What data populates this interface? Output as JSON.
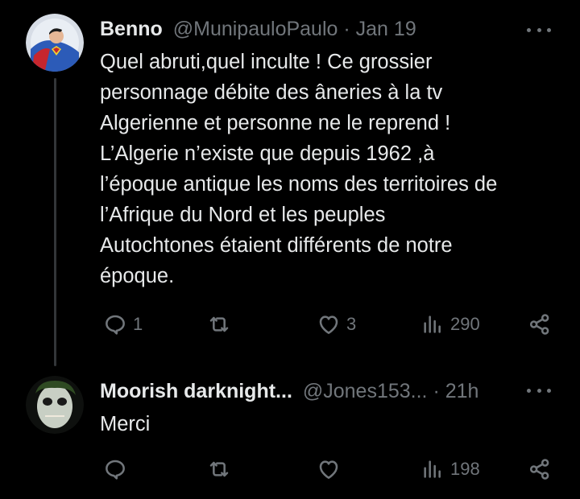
{
  "tweets": [
    {
      "author_name": "Benno",
      "handle": "@MunipauloPaulo",
      "separator": "·",
      "time": "Jan 19",
      "text_lines": [
        "Quel abruti,quel inculte ! Ce grossier",
        "personnage débite des âneries à la tv",
        "Algerienne et personne ne le reprend !",
        "L’Algerie n’existe que depuis 1962 ,à",
        "l’époque antique les noms des territoires de",
        "l’Afrique du Nord et les peuples",
        "Autochtones étaient différents de notre",
        "époque."
      ],
      "replies": "1",
      "retweets": "",
      "likes": "3",
      "views": "290",
      "avatar_icon": "superman-avatar-icon"
    },
    {
      "author_name": "Moorish darknight...",
      "handle": "@Jones153...",
      "separator": "·",
      "time": "21h",
      "text_lines": [
        "Merci"
      ],
      "replies": "",
      "retweets": "",
      "likes": "",
      "views": "198",
      "avatar_icon": "joker-avatar-icon"
    }
  ],
  "icons": {
    "reply": "reply-icon",
    "retweet": "retweet-icon",
    "like": "heart-icon",
    "views": "views-chart-icon",
    "share": "share-icon",
    "more": "more-options-icon"
  },
  "colors": {
    "background": "#000000",
    "text_primary": "#e7e9ea",
    "text_secondary": "#71767b",
    "thread_line": "#333639"
  }
}
